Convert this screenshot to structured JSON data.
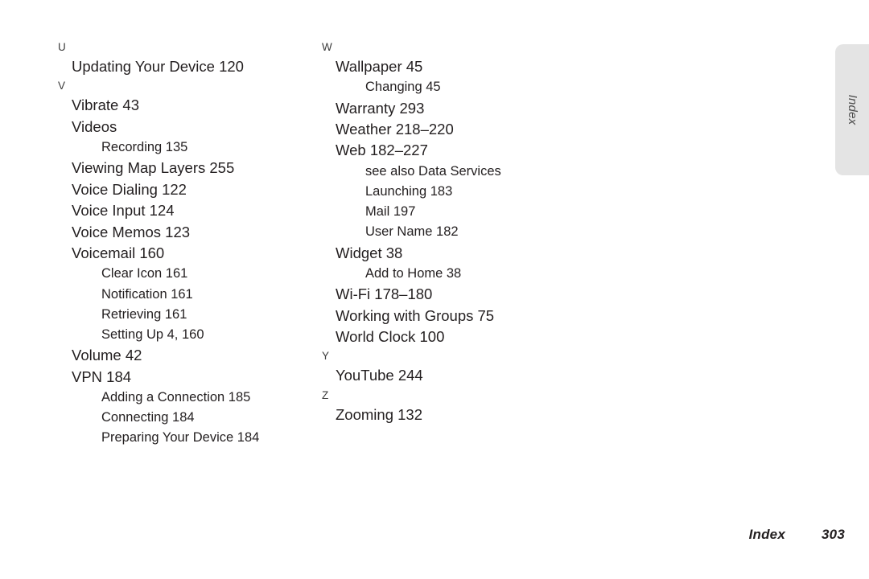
{
  "document": {
    "kind": "index-page",
    "page_number": "303",
    "footer_label": "Index",
    "side_tab_label": "Index",
    "side_tab_color": "#e4e4e4",
    "text_color": "#231f20"
  },
  "columns": [
    {
      "id": "left",
      "blocks": [
        {
          "letter": "U",
          "entries": [
            {
              "level": 1,
              "text": "Updating Your Device 120"
            }
          ]
        },
        {
          "letter": "V",
          "entries": [
            {
              "level": 1,
              "text": "Vibrate 43"
            },
            {
              "level": 1,
              "text": "Videos"
            },
            {
              "level": 2,
              "text": "Recording 135"
            },
            {
              "level": 1,
              "text": "Viewing Map Layers 255"
            },
            {
              "level": 1,
              "text": "Voice Dialing 122"
            },
            {
              "level": 1,
              "text": "Voice Input 124"
            },
            {
              "level": 1,
              "text": "Voice Memos 123"
            },
            {
              "level": 1,
              "text": "Voicemail 160"
            },
            {
              "level": 2,
              "text": "Clear Icon 161"
            },
            {
              "level": 2,
              "text": "Notification 161"
            },
            {
              "level": 2,
              "text": "Retrieving 161"
            },
            {
              "level": 2,
              "text": "Setting Up 4, 160"
            },
            {
              "level": 1,
              "text": "Volume 42"
            },
            {
              "level": 1,
              "text": "VPN 184"
            },
            {
              "level": 2,
              "text": "Adding a Connection 185"
            },
            {
              "level": 2,
              "text": "Connecting 184"
            },
            {
              "level": 2,
              "text": "Preparing Your Device 184"
            }
          ]
        }
      ]
    },
    {
      "id": "right",
      "blocks": [
        {
          "letter": "W",
          "entries": [
            {
              "level": 1,
              "text": "Wallpaper 45"
            },
            {
              "level": 2,
              "text": "Changing 45"
            },
            {
              "level": 1,
              "text": "Warranty 293"
            },
            {
              "level": 1,
              "text": "Weather 218–220"
            },
            {
              "level": 1,
              "text": "Web 182–227"
            },
            {
              "level": 2,
              "text": "see also Data Services"
            },
            {
              "level": 2,
              "text": "Launching 183"
            },
            {
              "level": 2,
              "text": "Mail 197"
            },
            {
              "level": 2,
              "text": "User Name 182"
            },
            {
              "level": 1,
              "text": "Widget 38"
            },
            {
              "level": 2,
              "text": "Add to Home 38"
            },
            {
              "level": 1,
              "text": "Wi-Fi 178–180"
            },
            {
              "level": 1,
              "text": "Working with Groups 75"
            },
            {
              "level": 1,
              "text": "World Clock 100"
            }
          ]
        },
        {
          "letter": "Y",
          "entries": [
            {
              "level": 1,
              "text": "YouTube 244"
            }
          ]
        },
        {
          "letter": "Z",
          "entries": [
            {
              "level": 1,
              "text": "Zooming 132"
            }
          ]
        }
      ]
    }
  ]
}
